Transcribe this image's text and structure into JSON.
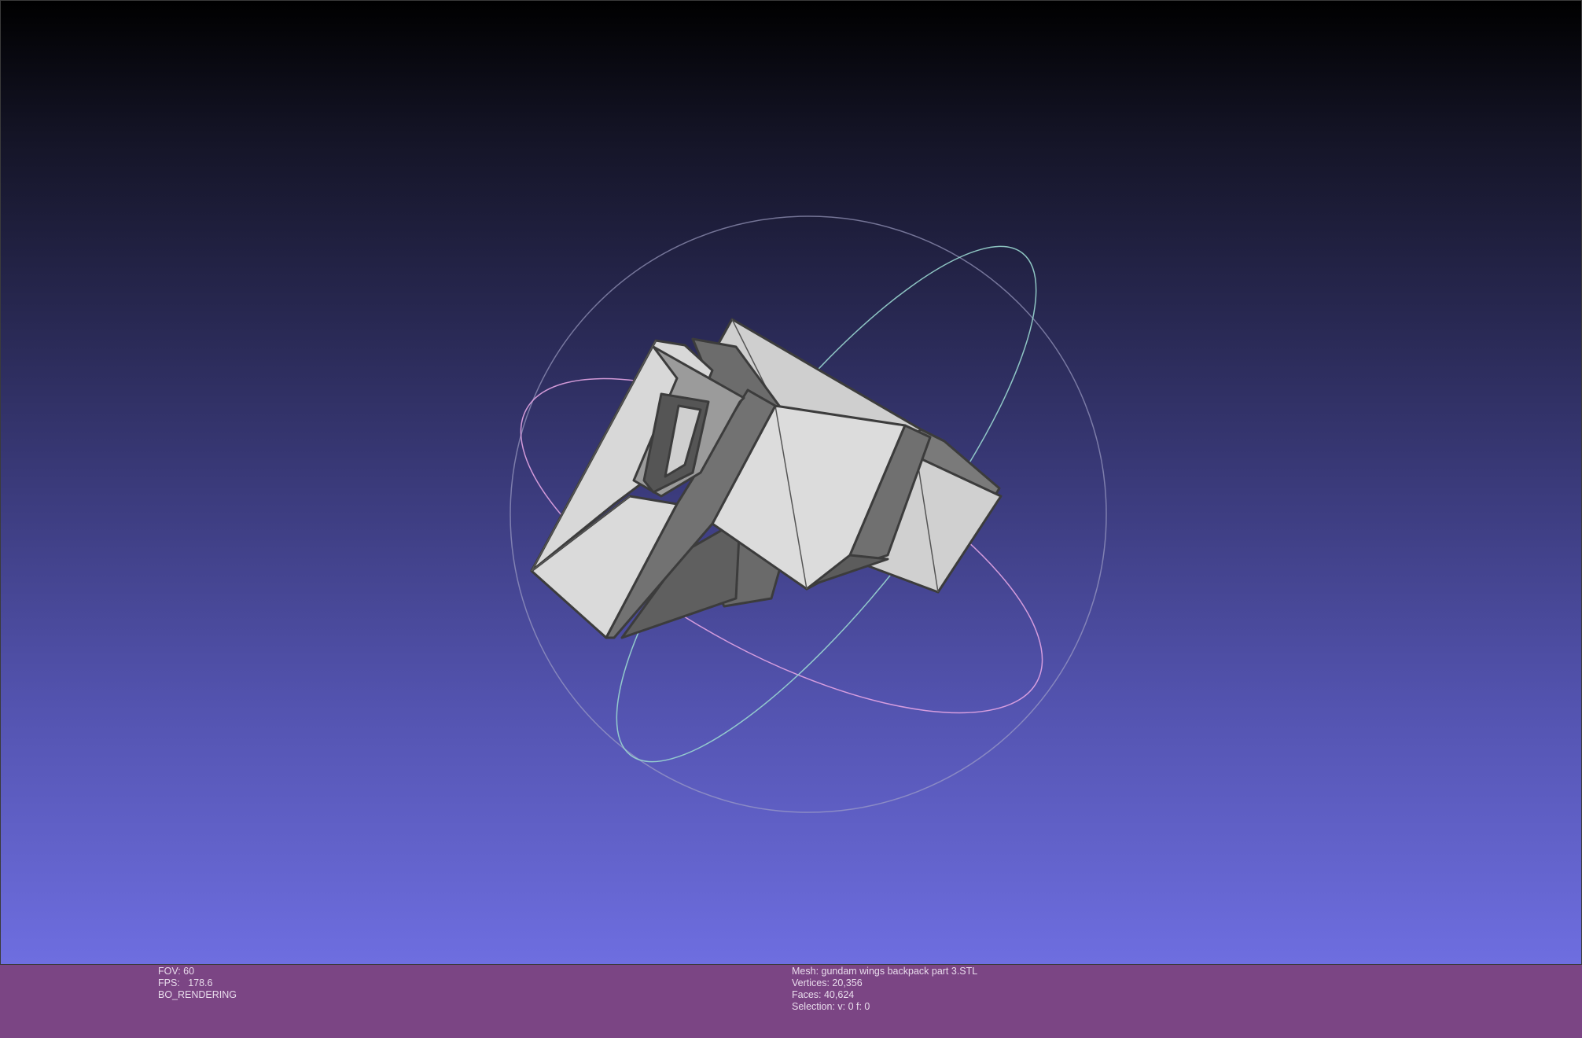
{
  "status": {
    "fov": "FOV: 60",
    "fps": "FPS:   178.6",
    "rendering": "BO_RENDERING",
    "mesh": "Mesh: gundam wings backpack part 3.STL",
    "vertices": "Vertices: 20,356",
    "faces": "Faces: 40,624",
    "selection": "Selection: v: 0 f: 0"
  },
  "colors": {
    "status_bar": "#7b4584",
    "status_text": "#e9dcec",
    "model_face": "#d9d9d9",
    "model_edge": "#444444",
    "trackball_blue": "#9ad7d0",
    "trackball_pink": "#e4a5e4",
    "trackball_gray": "#b7b7d0"
  },
  "icons": {
    "trackball": "trackball-gizmo"
  }
}
